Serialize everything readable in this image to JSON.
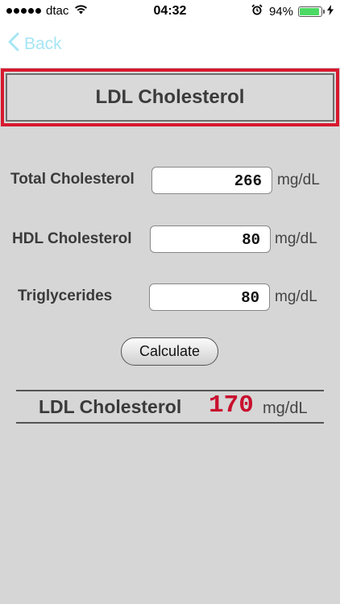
{
  "status_bar": {
    "carrier": "dtac",
    "time": "04:32",
    "battery_percent": "94%",
    "battery_level": 0.94,
    "icons": [
      "signal-dots-icon",
      "wifi-icon",
      "alarm-icon",
      "battery-icon",
      "charging-icon"
    ]
  },
  "nav": {
    "back_label": "Back",
    "back_color": "#a6e6f4"
  },
  "title": "LDL Cholesterol",
  "form": {
    "total": {
      "label": "Total Cholesterol",
      "value": "266",
      "unit": "mg/dL"
    },
    "hdl": {
      "label": "HDL Cholesterol",
      "value": "80",
      "unit": "mg/dL"
    },
    "trig": {
      "label": "Triglycerides",
      "value": "80",
      "unit": "mg/dL"
    }
  },
  "calculate_label": "Calculate",
  "result": {
    "label": "LDL Cholesterol",
    "value": "170",
    "unit": "mg/dL",
    "value_color": "#c8102e"
  },
  "colors": {
    "background": "#d6d6d6",
    "title_border": "#d7192f"
  }
}
